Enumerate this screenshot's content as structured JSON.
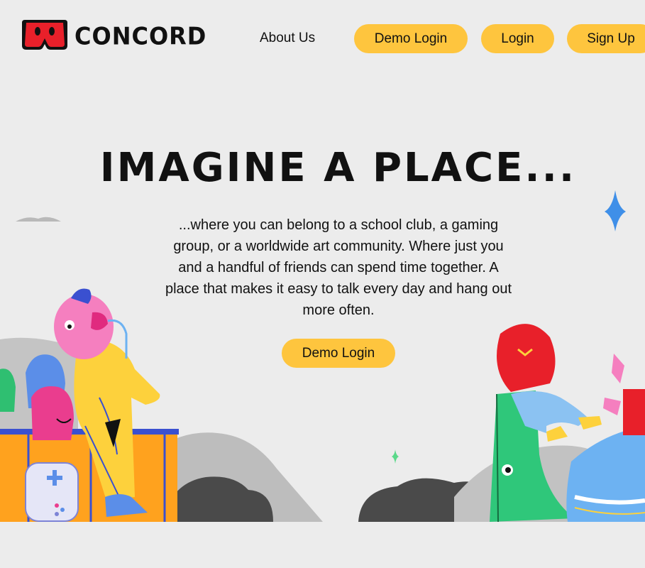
{
  "brand": {
    "name": "CONCORD",
    "logo_icon": "red-pants-logo"
  },
  "nav": {
    "about_label": "About Us",
    "demo_login_label": "Demo Login",
    "login_label": "Login",
    "signup_label": "Sign Up"
  },
  "hero": {
    "title": "IMAGINE A PLACE...",
    "body": "...where you can belong to a school club, a gaming group, or a worldwide art community. Where just you and a handful of friends can spend time together. A place that makes it easy to talk every day and hang out more often.",
    "cta_label": "Demo Login"
  },
  "colors": {
    "background": "#ececec",
    "accent": "#fec53e",
    "logo_red": "#e8202a",
    "sparkle_blue": "#3f8fe8"
  },
  "icons": [
    "sparkle-icon",
    "game-controller-icon"
  ]
}
